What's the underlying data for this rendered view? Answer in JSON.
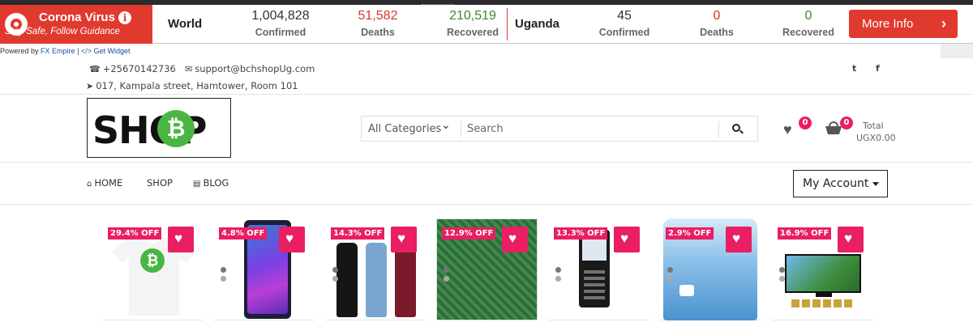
{
  "corona": {
    "title": "Corona Virus",
    "info_glyph": "i",
    "subtitle": "Stay Safe, Follow Guidance",
    "world": {
      "region": "World",
      "confirmed": "1,004,828",
      "deaths": "51,582",
      "recovered": "210,519"
    },
    "uganda": {
      "region": "Uganda",
      "confirmed": "45",
      "deaths": "0",
      "recovered": "0"
    },
    "labels": {
      "confirmed": "Confirmed",
      "deaths": "Deaths",
      "recovered": "Recovered"
    },
    "more_info": "More Info",
    "more_info_chevron": "›",
    "powered_prefix": "Powered by",
    "powered_link": "FX Empire",
    "powered_sep": "|",
    "widget_link": "</> Get Widget",
    "colors": {
      "brand_red": "#e03a2f",
      "deaths_red": "#d9362b",
      "recovered_green": "#3c8a2e"
    }
  },
  "contact": {
    "phone": "+25670142736",
    "email": "support@bchshopUg.com",
    "address": "017, Kampala street, Hamtower, Room 101",
    "phone_icon": "phone-icon",
    "email_icon": "envelope-icon",
    "address_icon": "location-arrow-icon",
    "social": {
      "twitter": "twitter-icon",
      "facebook": "facebook-icon",
      "twitter_glyph": "t",
      "facebook_glyph": "f"
    }
  },
  "header": {
    "logo_text": "SHOP",
    "logo_coin": "₿",
    "search": {
      "category": "All Categories",
      "placeholder": "Search"
    },
    "wishlist_count": "0",
    "cart_count": "0",
    "total_label": "Total",
    "total_value": "UGX0.00"
  },
  "nav": {
    "items": [
      "HOME",
      "SHOP",
      "BLOG"
    ],
    "account": "My Account"
  },
  "products": [
    {
      "discount": "29.4% OFF",
      "kind": "t-shirt"
    },
    {
      "discount": "4.8% OFF",
      "kind": "smartphone"
    },
    {
      "discount": "14.3% OFF",
      "kind": "leggings"
    },
    {
      "discount": "12.9% OFF",
      "kind": "scarf"
    },
    {
      "discount": "13.3% OFF",
      "kind": "feature-phone"
    },
    {
      "discount": "2.9% OFF",
      "kind": "water-dispenser"
    },
    {
      "discount": "16.9% OFF",
      "kind": "television"
    }
  ],
  "colors": {
    "accent_pink": "#e91e63"
  }
}
